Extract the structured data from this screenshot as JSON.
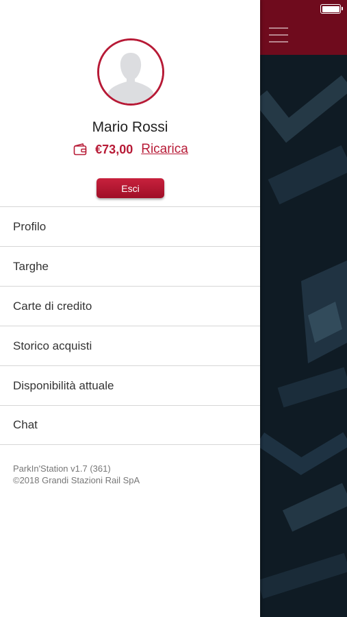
{
  "user": {
    "name": "Mario Rossi",
    "balance": "€73,00",
    "recharge_label": "Ricarica"
  },
  "logout_label": "Esci",
  "menu": {
    "items": [
      {
        "label": "Profilo"
      },
      {
        "label": "Targhe"
      },
      {
        "label": "Carte di credito"
      },
      {
        "label": "Storico acquisti"
      },
      {
        "label": "Disponibilità attuale"
      },
      {
        "label": "Chat"
      }
    ]
  },
  "footer": {
    "version": "ParkIn'Station v1.7 (361)",
    "copyright": "©2018 Grandi Stazioni Rail SpA"
  },
  "icons": {
    "avatar": "user-silhouette-icon",
    "wallet": "wallet-icon",
    "menu": "hamburger-menu-icon",
    "battery": "battery-icon"
  },
  "colors": {
    "accent": "#b71a36",
    "header_bg": "#6f0b1d",
    "background_dark": "#0f1b24",
    "divider": "#d6d6d6"
  }
}
